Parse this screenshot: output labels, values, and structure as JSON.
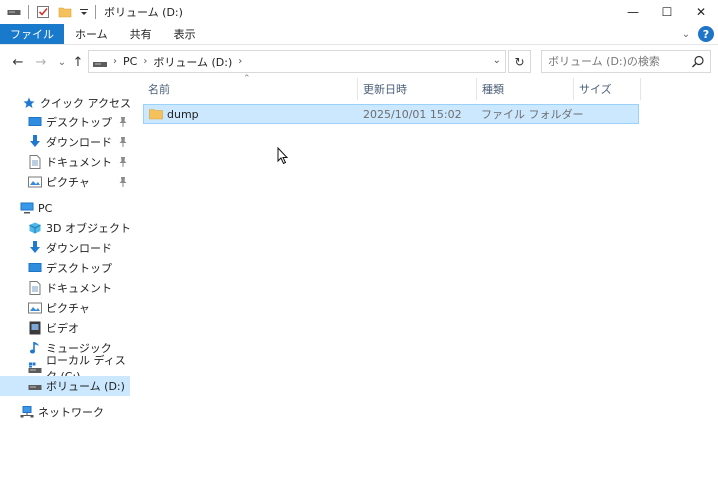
{
  "window": {
    "title": "ボリューム (D:)",
    "minimize": "—",
    "maximize": "☐",
    "close": "✕"
  },
  "ribbon": {
    "tabs": [
      "ファイル",
      "ホーム",
      "共有",
      "表示"
    ],
    "expand_chevron": "⌄",
    "help": "?"
  },
  "nav": {
    "back": "←",
    "forward": "→",
    "recent": "⌄",
    "up": "↑",
    "breadcrumb": [
      "PC",
      "ボリューム (D:)"
    ],
    "refresh": "↻",
    "search_placeholder": "ボリューム (D:)の検索"
  },
  "sidebar": {
    "quick_access": "クイック アクセス",
    "quick_items": [
      "デスクトップ",
      "ダウンロード",
      "ドキュメント",
      "ピクチャ"
    ],
    "pc": "PC",
    "pc_items": [
      "3D オブジェクト",
      "ダウンロード",
      "デスクトップ",
      "ドキュメント",
      "ピクチャ",
      "ビデオ",
      "ミュージック",
      "ローカル ディスク (C:)",
      "ボリューム (D:)"
    ],
    "network": "ネットワーク"
  },
  "columns": {
    "name": "名前",
    "modified": "更新日時",
    "type": "種類",
    "size": "サイズ"
  },
  "files": [
    {
      "name": "dump",
      "modified": "2025/10/01 15:02",
      "type": "ファイル フォルダー",
      "size": ""
    }
  ],
  "colors": {
    "accent": "#1979ca",
    "selection": "#cce8ff",
    "selection_border": "#99d1ff",
    "folder": "#f4c15a"
  }
}
